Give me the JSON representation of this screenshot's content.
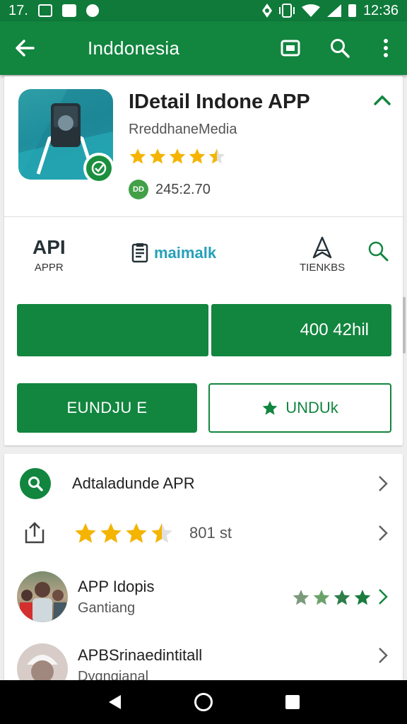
{
  "status": {
    "left_text": "17.",
    "time": "12:36"
  },
  "app_bar": {
    "title": "Inddonesia"
  },
  "app": {
    "name": "IDetail Indone APP",
    "developer": "RreddhaneMedia",
    "rating_stars": 4.5,
    "download_badge": "DD",
    "download_count": "245:2.70"
  },
  "tabs": [
    {
      "big": "API",
      "small": "APPR"
    },
    {
      "label": "maimalk"
    },
    {
      "small": "TIENKBS"
    }
  ],
  "progress_bar": {
    "label": "400 42hil"
  },
  "buttons": {
    "primary": "EUNDJU E",
    "secondary": "UNDUk"
  },
  "list": [
    {
      "title": "Adtaladunde APR"
    },
    {
      "rating_stars": 3.5,
      "value": "801 st"
    },
    {
      "title": "APP Idopis",
      "subtitle": "Gantiang",
      "rating_stars": 4
    },
    {
      "title": "APBSrinaedintitall",
      "subtitle": "Dygngianal"
    }
  ],
  "colors": {
    "brand": "#12853f",
    "status_bar": "#0f7a3a",
    "star": "#f4b400",
    "accent_teal": "#26a0b8"
  },
  "icons": [
    "back-arrow-icon",
    "cast-icon",
    "search-icon",
    "more-vert-icon",
    "share-icon",
    "home-nav-icon"
  ]
}
